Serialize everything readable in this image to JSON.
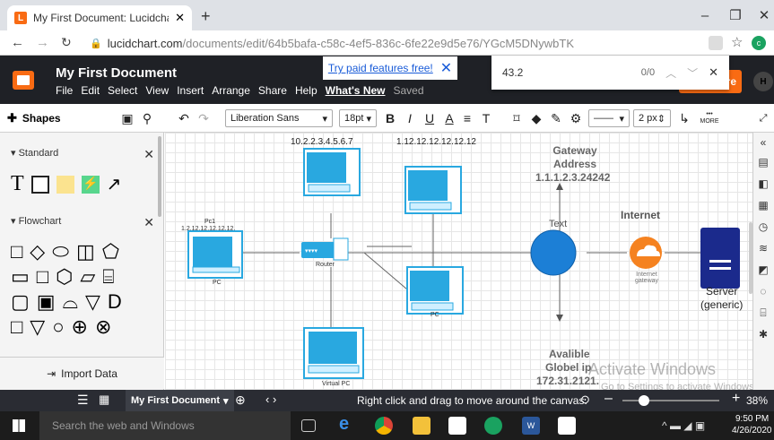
{
  "browser": {
    "tab_title": "My First Document: Lucidchart",
    "url_host": "lucidchart.com",
    "url_path": "/documents/edit/64b5bafa-c58c-4ef5-836c-6fe22e9d5e76/YGcM5DNywbTK",
    "favicon": "L"
  },
  "app": {
    "doc_title": "My First Document",
    "menus": [
      "File",
      "Edit",
      "Select",
      "View",
      "Insert",
      "Arrange",
      "Share",
      "Help"
    ],
    "whats_new": "What's New",
    "saved": "Saved",
    "promo": "Try paid features free!",
    "share": "re",
    "avatar": "H"
  },
  "find": {
    "query": "43.2",
    "count": "0/0"
  },
  "toolbar": {
    "shapes": "Shapes",
    "font": "Liberation Sans",
    "size": "18pt",
    "line_width": "2 px",
    "more": "MORE"
  },
  "panel": {
    "standard": "Standard",
    "flowchart": "Flowchart",
    "import": "Import Data"
  },
  "diagram": {
    "ip_top_left": "10.2.2.3.4.5.6.7",
    "ip_top_mid": "1.12.12.12.12.12.12",
    "pc1": "Pc1",
    "pc1_ip": "1.2.12.12.12.12.12.",
    "pc_label": "PC",
    "router_label": "Router",
    "gateway1": "Gateway",
    "gateway2": "Address",
    "gateway3": "1.1.1.2.3.24242",
    "text_label": "Text",
    "internet": "Internet",
    "internet_cloud": "Internet gateway",
    "server1": "Server",
    "server2": "(generic)",
    "virtual_pc": "Virtual PC",
    "avail1": "Avalible",
    "avail2": "Globel ip",
    "avail3": "172.31.2121."
  },
  "watermark": {
    "line1": "Activate Windows",
    "line2": "Go to Settings to activate Windows."
  },
  "status": {
    "page_tab": "My First Document",
    "hint": "Right click and drag to move around the canvas.",
    "zoom": "38%"
  },
  "taskbar": {
    "search": "Search the web and Windows",
    "time": "9:50 PM",
    "date": "4/26/2020"
  },
  "colors": {
    "accent": "#f96b13",
    "circle": "#1c7fd6",
    "cloud": "#f58220",
    "server": "#1b2a8c",
    "pc": "#29a8e0"
  }
}
